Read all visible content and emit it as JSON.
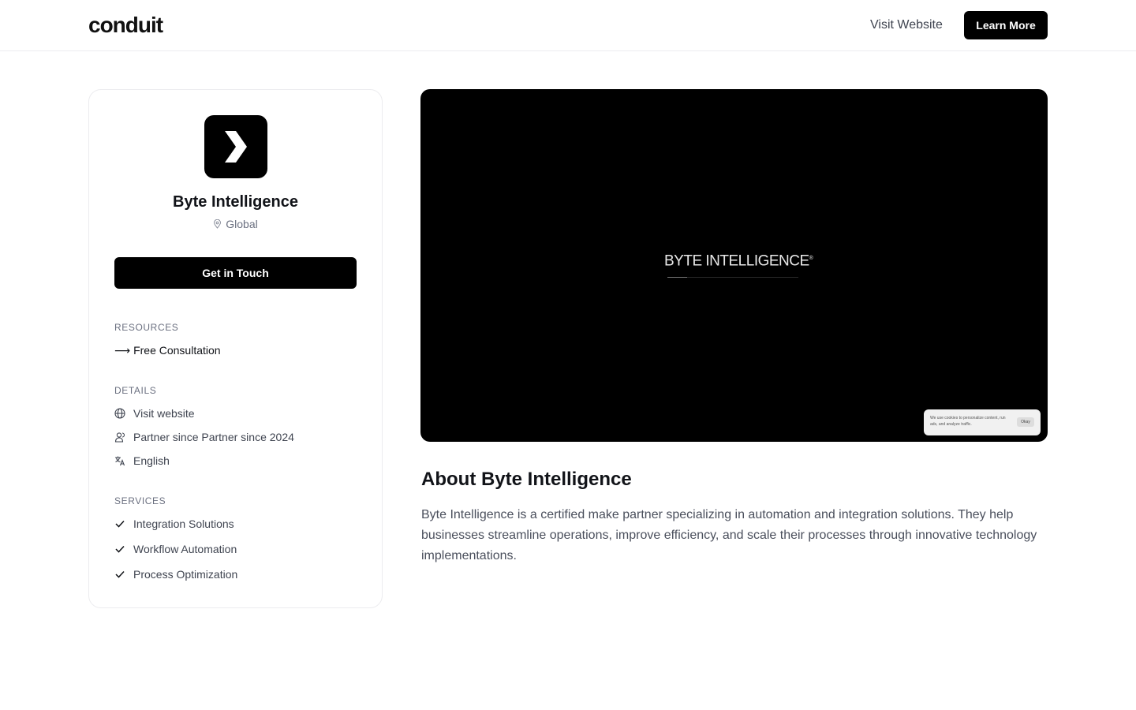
{
  "header": {
    "logo": "conduit",
    "visit_website": "Visit Website",
    "learn_more": "Learn More"
  },
  "profile": {
    "name": "Byte Intelligence",
    "location": "Global",
    "cta": "Get in Touch",
    "logo_icon": "chevron-right-icon"
  },
  "resources": {
    "label": "RESOURCES",
    "arrow": "⟶",
    "items": [
      "Free Consultation"
    ]
  },
  "details": {
    "label": "DETAILS",
    "website": "Visit website",
    "partner_since": "Partner since Partner since 2024",
    "language": "English"
  },
  "services": {
    "label": "SERVICES",
    "items": [
      "Integration Solutions",
      "Workflow Automation",
      "Process Optimization"
    ]
  },
  "video": {
    "title": "BYTE INTELLIGENCE",
    "registered": "®",
    "progress": 0.15,
    "cookie_text": "We use cookies to personalize content, run ads, and analyze traffic.",
    "cookie_button": "Okay"
  },
  "about": {
    "title": "About Byte Intelligence",
    "body": "Byte Intelligence is a certified make partner specializing in automation and integration solutions. They help businesses streamline operations, improve efficiency, and scale their processes through innovative technology implementations."
  },
  "colors": {
    "primary": "#000000",
    "text": "#111318",
    "muted": "#6b7080",
    "border": "#ececef"
  }
}
